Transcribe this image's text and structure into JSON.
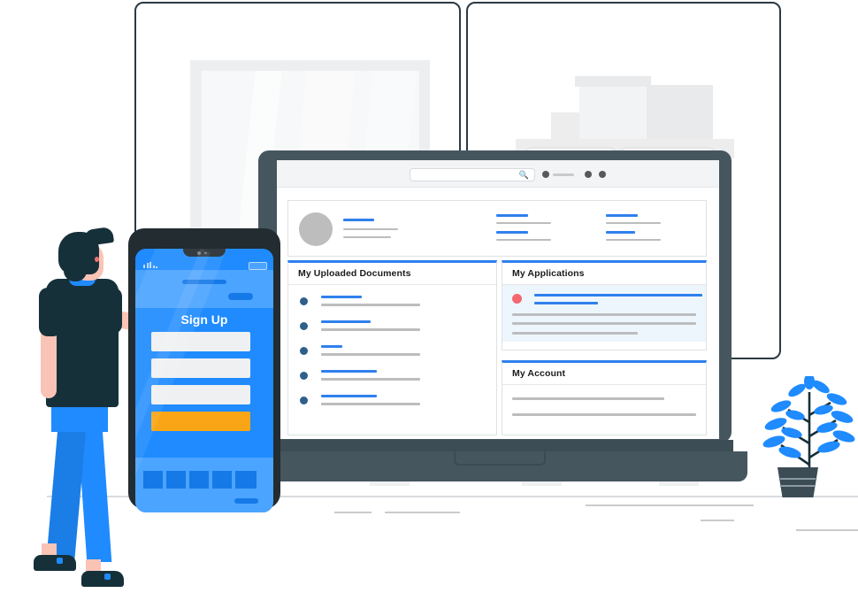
{
  "scene": {
    "title": "Online document and application portal illustration",
    "palette": {
      "primary_blue": "#2f80ed",
      "phone_blue": "#1f8bff",
      "phone_blue_light": "#4ba4ff",
      "phone_blue_dark": "#1679e8",
      "orange": "#f9a515",
      "dark_navy": "#16303a",
      "slate": "#45565f",
      "red_dot": "#f4676f",
      "gray_line": "#bcbdbf",
      "panel_gray": "#eceef0",
      "card_blue_bg": "#eef6fd"
    }
  },
  "laptop": {
    "browser": {
      "search_placeholder": "",
      "search_value": "",
      "search_icon": "search-icon",
      "control_icons": [
        "dot-icon",
        "dash-icon",
        "dot-icon",
        "dot-icon"
      ]
    },
    "profile_card": {
      "avatar": "avatar-placeholder",
      "name_line": "blue-line",
      "detail_lines": 2,
      "stats": [
        {
          "label_line": "blue-line",
          "value_line": "gray-line",
          "label_line_2": "blue-line",
          "value_line_2": "gray-line"
        },
        {
          "label_line": "blue-line",
          "value_line": "gray-line",
          "label_line_2": "blue-line",
          "value_line_2": "gray-line"
        }
      ]
    },
    "cards": [
      {
        "id": "uploaded-documents",
        "title": "My Uploaded Documents",
        "accent": "#2f80ed",
        "body_bg": "#ffffff",
        "items": [
          {
            "bullet": "#2e5f8a",
            "title_width": 46,
            "sub_width": 112
          },
          {
            "bullet": "#2e5f8a",
            "title_width": 56,
            "sub_width": 112
          },
          {
            "bullet": "#2e5f8a",
            "title_width": 24,
            "sub_width": 112
          },
          {
            "bullet": "#2e5f8a",
            "title_width": 63,
            "sub_width": 112
          },
          {
            "bullet": "#2e5f8a",
            "title_width": 63,
            "sub_width": 112
          }
        ]
      },
      {
        "id": "applications",
        "title": "My Applications",
        "accent": "#2f80ed",
        "body_bg": "#eef6fd",
        "entry": {
          "bullet": "#f4676f",
          "title_width": 190,
          "subtitle_width": 72,
          "text_lines": [
            208,
            208,
            142
          ]
        }
      },
      {
        "id": "account",
        "title": "My Account",
        "accent": "#2f80ed",
        "body_bg": "#ffffff",
        "text_lines": [
          172,
          208
        ]
      }
    ]
  },
  "phone": {
    "status_bar": {
      "signal_icon": "signal-bars-icon",
      "battery_icon": "battery-icon"
    },
    "header": {
      "title_bar": "pill",
      "action_chip": "pill"
    },
    "screen_title": "Sign Up",
    "form_fields": [
      {
        "name": "field-1",
        "value": "",
        "placeholder": ""
      },
      {
        "name": "field-2",
        "value": "",
        "placeholder": ""
      },
      {
        "name": "field-3",
        "value": "",
        "placeholder": ""
      }
    ],
    "submit_button": {
      "label": "",
      "color": "#f9a515"
    },
    "bottom_nav": [
      {
        "name": "nav-item-1",
        "icon": "square-icon"
      },
      {
        "name": "nav-item-2",
        "icon": "square-icon"
      },
      {
        "name": "nav-item-3",
        "icon": "square-icon"
      },
      {
        "name": "nav-item-4",
        "icon": "square-icon"
      },
      {
        "name": "nav-item-5",
        "icon": "square-icon"
      }
    ],
    "home_indicator": "home-indicator"
  },
  "person": {
    "description": "person-standing-back-view",
    "pose": "reaching-to-phone"
  },
  "plant": {
    "description": "potted-plant",
    "leaf_color": "#1f8bff",
    "pot_color": "#3b4c55"
  }
}
